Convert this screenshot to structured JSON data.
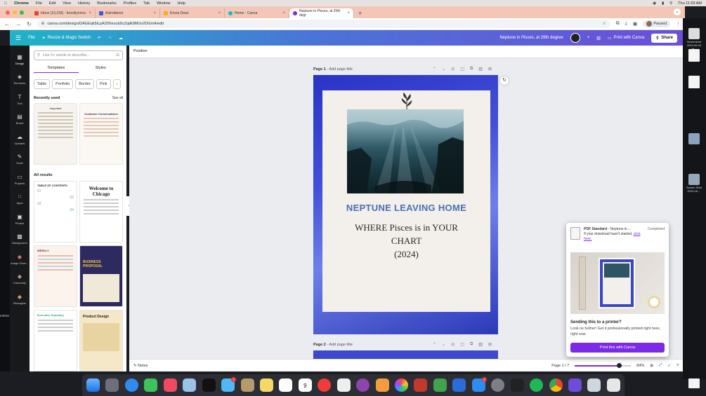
{
  "menubar": {
    "app": "Chrome",
    "items": [
      "File",
      "Edit",
      "View",
      "History",
      "Bookmarks",
      "Profiles",
      "Tab",
      "Window",
      "Help"
    ],
    "clock": "Thu 11:59 AM"
  },
  "tabs": [
    {
      "label": "Inbox (10,218) - brooklynmcc",
      "color": "#ea4335"
    },
    {
      "label": "Astrodienst",
      "color": "#3b5bdb"
    },
    {
      "label": "Krena Dean",
      "color": "#f4b400"
    },
    {
      "label": "Home - Canva",
      "color": "#00c4cc"
    },
    {
      "label": "Neptune in Pisces, at 29th degr",
      "color": "#7d2ae8",
      "active": true
    }
  ],
  "address": {
    "url": "canva.com/design/DAGEqk5iLpA/2fXeoub9cZqdk9MUv2DGmA/edit",
    "paused_label": "Paused"
  },
  "canva_header": {
    "file": "File",
    "resize": "Resize & Magic Switch",
    "doc_title": "Neptune in Pisces, at 29th degree",
    "print_label": "Print with Canva",
    "share_label": "Share"
  },
  "rail": [
    {
      "label": "Design",
      "icon": "layout-icon"
    },
    {
      "label": "Elements",
      "icon": "shapes-icon"
    },
    {
      "label": "Text",
      "icon": "text-icon"
    },
    {
      "label": "Brand",
      "icon": "briefcase-icon"
    },
    {
      "label": "Uploads",
      "icon": "cloud-upload-icon"
    },
    {
      "label": "Draw",
      "icon": "pen-icon"
    },
    {
      "label": "Projects",
      "icon": "folder-icon"
    },
    {
      "label": "Apps",
      "icon": "grid-icon"
    },
    {
      "label": "Photos",
      "icon": "image-icon"
    },
    {
      "label": "Background",
      "icon": "background-icon"
    },
    {
      "label": "Image Gene...",
      "icon": "magic-image-icon"
    },
    {
      "label": "Cartoonify",
      "icon": "cartoonify-icon"
    },
    {
      "label": "Remagine",
      "icon": "remagine-icon"
    }
  ],
  "panel": {
    "search_placeholder": "Use 5+ words to describe...",
    "tab_templates": "Templates",
    "tab_styles": "Styles",
    "chips": [
      "Table",
      "Portfolio",
      "Border",
      "Pink"
    ],
    "recent_label": "Recently used",
    "see_all": "See all",
    "all_results": "All results",
    "thumbs": {
      "t1_title": "Important",
      "t2_title": "Customer Conversations",
      "t3_title": "TABLE OF CONTENTS",
      "t3_nums": [
        "01",
        "02",
        "03",
        "04"
      ],
      "t4_title": "Welcome to Chicago",
      "t5_title": "WEEKLY",
      "t6_title": "BUSINESS PROPOSAL",
      "t7_title": "Executive Summary",
      "t8_title": "Product Design"
    }
  },
  "workspace": {
    "position_label": "Position",
    "page1_label": "Page 1",
    "page2_label": "Page 2",
    "add_title": "- Add page title",
    "design_title": "NEPTUNE LEAVING HOME",
    "design_line1": "WHERE Pisces is in YOUR",
    "design_line2": "CHART",
    "design_line3": "(2024)"
  },
  "footer": {
    "notes": "Notes",
    "page_counter": "Page 1 / 7",
    "zoom": "84%",
    "zoom_value": 0.84
  },
  "popup": {
    "file_label": "PDF Standard",
    "file_name": "Neptune in ...",
    "status": "Completed",
    "retry_text": "If your download hasn't started,",
    "retry_link": "click here.",
    "heading": "Sending this to a printer?",
    "body": "Look no further! Get it professionally printed right here, right now.",
    "button": "Print this with Canva"
  },
  "desktop": {
    "left_text": "mRSS",
    "icons": [
      "Screenshot 2024-05-16 at...",
      "Screen Shot 2024-05-..."
    ]
  },
  "dock": {
    "calendar_day": "9",
    "badges": {
      "messages": "3",
      "appstore": "4"
    }
  }
}
